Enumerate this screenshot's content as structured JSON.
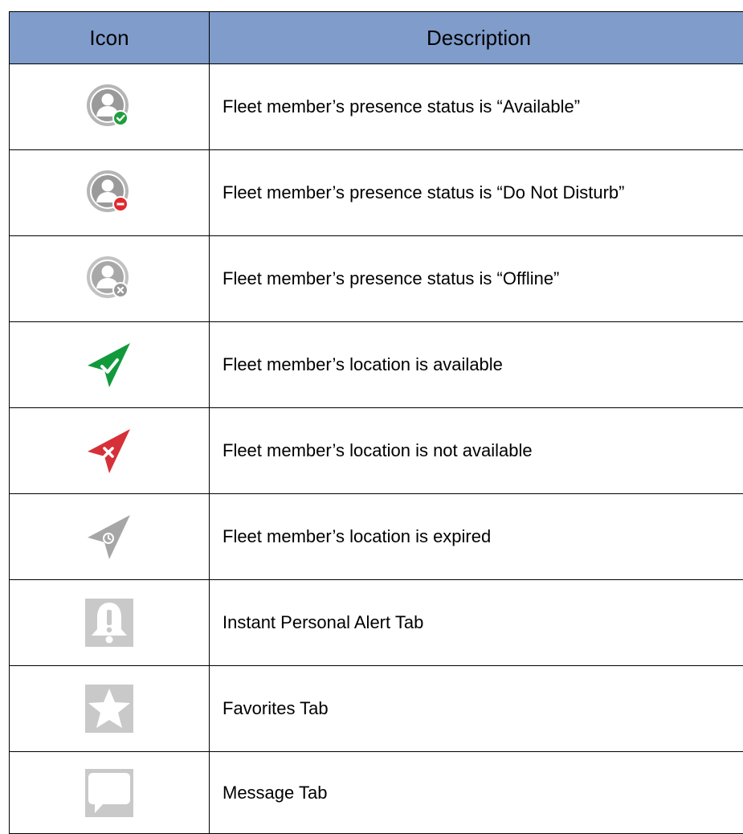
{
  "header": {
    "icon_col": "Icon",
    "description_col": "Description"
  },
  "colors": {
    "header_bg": "#7f9ccb",
    "available_green": "#1e9e3e",
    "dnd_red": "#e3262d",
    "offline_gray": "#9a9a9a",
    "location_green": "#119a3c",
    "location_red": "#d63138",
    "location_gray": "#a6a6a6",
    "tab_icon_gray": "#bdbdbd"
  },
  "rows": [
    {
      "icon": "presence-available-icon",
      "description": "Fleet member’s presence status is “Available”"
    },
    {
      "icon": "presence-do-not-disturb-icon",
      "description": "Fleet member’s presence status is “Do Not Disturb”"
    },
    {
      "icon": "presence-offline-icon",
      "description": "Fleet member’s presence status is “Offline”"
    },
    {
      "icon": "location-available-icon",
      "description": "Fleet member’s location is available"
    },
    {
      "icon": "location-not-available-icon",
      "description": "Fleet member’s location is not available"
    },
    {
      "icon": "location-expired-icon",
      "description": "Fleet member’s location is expired"
    },
    {
      "icon": "instant-personal-alert-tab-icon",
      "description": "Instant Personal Alert Tab"
    },
    {
      "icon": "favorites-tab-icon",
      "description": "Favorites Tab"
    },
    {
      "icon": "message-tab-icon",
      "description": "Message Tab"
    }
  ]
}
